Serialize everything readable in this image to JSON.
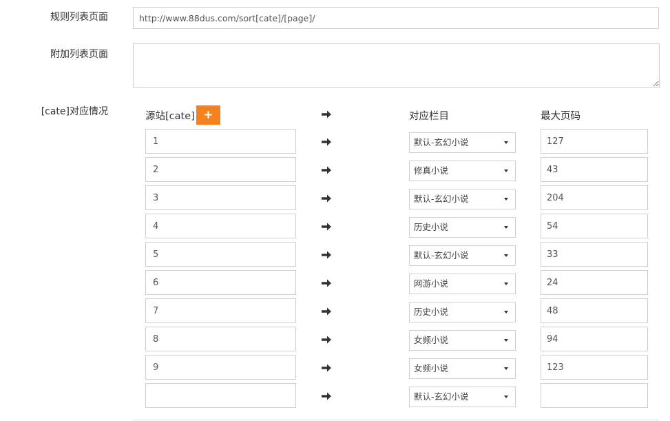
{
  "form": {
    "rule_list_label": "规则列表页面",
    "rule_list_value": "http://www.88dus.com/sort[cate]/[page]/",
    "extra_list_label": "附加列表页面",
    "extra_list_value": "",
    "cate_mapping_label": "[cate]对应情况"
  },
  "mapping": {
    "col_source": "源站[cate]",
    "add_button": "+",
    "col_category": "对应栏目",
    "col_max_page": "最大页码",
    "arrow_icon": "arrow-right-icon",
    "rows": [
      {
        "source": "1",
        "category": "默认-玄幻小说",
        "max_page": "127"
      },
      {
        "source": "2",
        "category": "修真小说",
        "max_page": "43"
      },
      {
        "source": "3",
        "category": "默认-玄幻小说",
        "max_page": "204"
      },
      {
        "source": "4",
        "category": "历史小说",
        "max_page": "54"
      },
      {
        "source": "5",
        "category": "默认-玄幻小说",
        "max_page": "33"
      },
      {
        "source": "6",
        "category": "网游小说",
        "max_page": "24"
      },
      {
        "source": "7",
        "category": "历史小说",
        "max_page": "48"
      },
      {
        "source": "8",
        "category": "女频小说",
        "max_page": "94"
      },
      {
        "source": "9",
        "category": "女频小说",
        "max_page": "123"
      },
      {
        "source": "",
        "category": "默认-玄幻小说",
        "max_page": ""
      }
    ]
  },
  "colors": {
    "accent": "#f58220",
    "border": "#cfcfcf"
  }
}
